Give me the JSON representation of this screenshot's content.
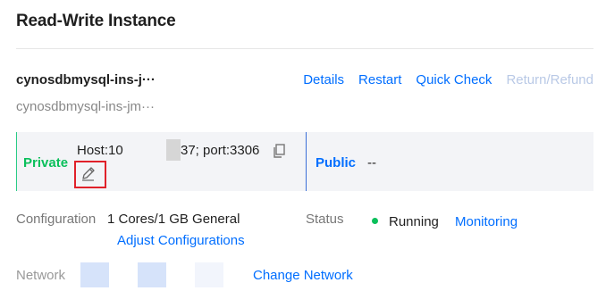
{
  "section": {
    "title": "Read-Write Instance"
  },
  "instance": {
    "name": "cynosdbmysql-ins-j···",
    "id": "cynosdbmysql-ins-jm···"
  },
  "actions": {
    "details": "Details",
    "restart": "Restart",
    "quick_check": "Quick Check",
    "return_refund": "Return/Refund"
  },
  "network": {
    "private_label": "Private",
    "host_prefix": "Host:10",
    "host_suffix": "37; port:3306",
    "public_label": "Public",
    "public_value": "--"
  },
  "configuration": {
    "label": "Configuration",
    "value": "1 Cores/1 GB General",
    "adjust_link": "Adjust Configurations"
  },
  "status": {
    "label": "Status",
    "value": "Running",
    "monitoring_link": "Monitoring",
    "dot_color": "#0abf5b"
  },
  "network_row": {
    "label": "Network",
    "change_link": "Change Network"
  },
  "icons": {
    "copy": "copy-icon",
    "edit": "pencil-icon"
  },
  "colors": {
    "link": "#006eff",
    "private": "#0abf5b",
    "highlight_box": "#e0212a"
  }
}
